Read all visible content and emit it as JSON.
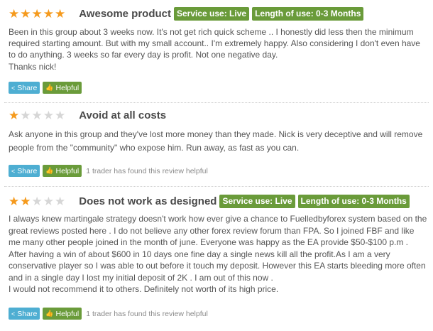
{
  "reviews": [
    {
      "rating": 5,
      "title": "Awesome product",
      "badges": [
        "Service use: Live",
        "Length of use: 0-3 Months"
      ],
      "paragraphs": [
        "Been in this group about 3 weeks now. It's not get rich quick scheme .. I honestly did less then the minimum required starting amount. But with my small account.. I'm extremely happy. Also considering I don't even have to do anything. 3 weeks so far every day is profit. Not one negative day.",
        "Thanks nick!"
      ],
      "share_label": "Share",
      "helpful_label": "Helpful",
      "helpful_count_text": ""
    },
    {
      "rating": 1,
      "title": "Avoid at all costs",
      "badges": [],
      "paragraphs": [
        "Ask anyone in this group and they've lost more money than they made. Nick is very deceptive and will remove people from the \"community\" who expose him. Run away, as fast as you can."
      ],
      "share_label": "Share",
      "helpful_label": "Helpful",
      "helpful_count_text": "1 trader has found this review helpful"
    },
    {
      "rating": 2,
      "title": "Does not work as designed",
      "badges": [
        "Service use: Live",
        "Length of use: 0-3 Months"
      ],
      "paragraphs": [
        "I always knew martingale strategy doesn't work how ever give a chance to Fuelledbyforex system based on the great reviews posted here . I do not believe any other forex review forum than FPA. So I joined FBF and like me many other people joined in the month of june. Everyone was happy as the EA provide $50-$100 p.m . After having a win of about $600 in 10 days one fine day a single news kill all the profit.As I am a very conservative player so I was able to out before it touch my deposit. However this EA starts bleeding more often and in a single day I lost my initial deposit of 2K . I am out of this now .",
        "I would not recommend it to others. Definitely not worth of its high price."
      ],
      "share_label": "Share",
      "helpful_label": "Helpful",
      "helpful_count_text": "1 trader has found this review helpful"
    }
  ],
  "icons": {
    "star": "star-icon",
    "share": "share-icon",
    "helpful": "thumbs-up-icon"
  },
  "colors": {
    "star_on": "#f59a1d",
    "star_off": "#d6d6d6",
    "badge": "#6a9b3a",
    "share": "#4eaed2"
  }
}
